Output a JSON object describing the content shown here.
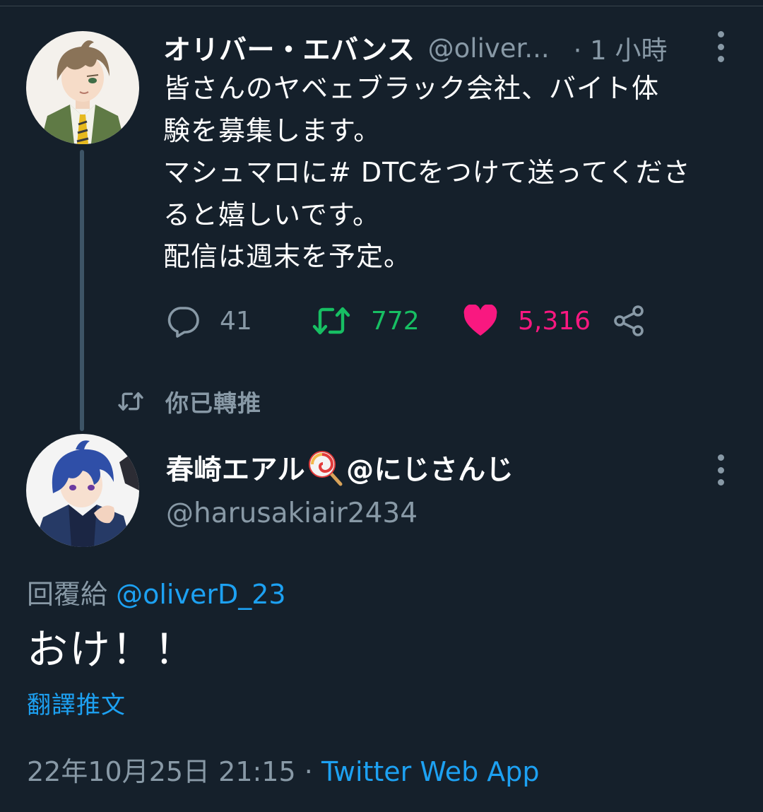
{
  "colors": {
    "background": "#15202b",
    "text_primary": "#ffffff",
    "text_secondary": "#8899a6",
    "link": "#1da1f2",
    "retweet_active": "#17bf63",
    "like_active": "#e0245e"
  },
  "tweet": {
    "author_name": "オリバー・エバンス",
    "handle": "@oliver...",
    "time": "· 1 小時",
    "body_lines": [
      "皆さんのヤベェブラック会社、バイト体",
      "験を募集します。",
      "マシュマロに# DTCをつけて送ってくださ",
      "ると嬉しいです。",
      "配信は週末を予定。"
    ],
    "reply_count": "41",
    "retweet_count": "772",
    "like_count": "5,316",
    "icons": {
      "reply": "speech-bubble-icon",
      "retweet": "retweet-arrows-icon",
      "like": "heart-icon",
      "share": "share-nodes-icon",
      "more": "vertical-ellipsis-icon"
    }
  },
  "retweet_indicator": {
    "label": "你已轉推",
    "icon": "retweet-arrows-icon"
  },
  "reply": {
    "author_name": "春崎エアル",
    "name_emoji": "lollipop-icon",
    "name_suffix": "@にじさんじ",
    "handle": "@harusakiair2434",
    "replying_to_label": "回覆給",
    "replying_to_mention": "@oliverD_23",
    "body": "おけ！！",
    "translate_label": "翻譯推文",
    "timestamp": "22年10月25日 21:15",
    "separator": "·",
    "source": "Twitter Web App"
  }
}
